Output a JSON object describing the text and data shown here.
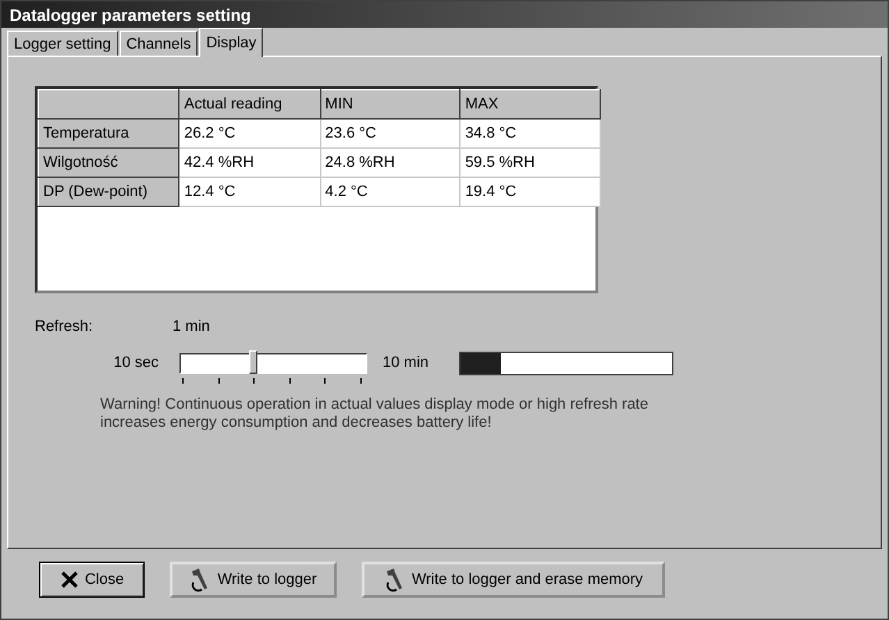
{
  "window": {
    "title": "Datalogger parameters setting"
  },
  "tabs": [
    {
      "label": "Logger setting",
      "selected": false
    },
    {
      "label": "Channels",
      "selected": false
    },
    {
      "label": "Display",
      "selected": true
    }
  ],
  "table": {
    "columns": [
      "Actual reading",
      "MIN",
      "MAX"
    ],
    "rows": [
      {
        "name": "Temperatura",
        "cells": [
          "26.2 °C",
          "23.6 °C",
          "34.8 °C"
        ]
      },
      {
        "name": "Wilgotność",
        "cells": [
          "42.4 %RH",
          "24.8 %RH",
          "59.5 %RH"
        ]
      },
      {
        "name": "DP (Dew-point)",
        "cells": [
          "12.4 °C",
          "4.2 °C",
          "19.4 °C"
        ]
      }
    ]
  },
  "refresh": {
    "label": "Refresh:",
    "value": "1 min",
    "min_label": "10 sec",
    "max_label": "10 min",
    "level": 0.4,
    "progress": {
      "level": 0.19
    }
  },
  "warning": "Warning! Continuous operation in actual values display mode or high refresh rate increases energy consumption and decreases battery life!",
  "buttons": [
    {
      "kind": "close",
      "label": "Close"
    },
    {
      "kind": "write",
      "label": "Write to logger"
    },
    {
      "kind": "write",
      "label": "Write to logger and erase memory"
    }
  ]
}
